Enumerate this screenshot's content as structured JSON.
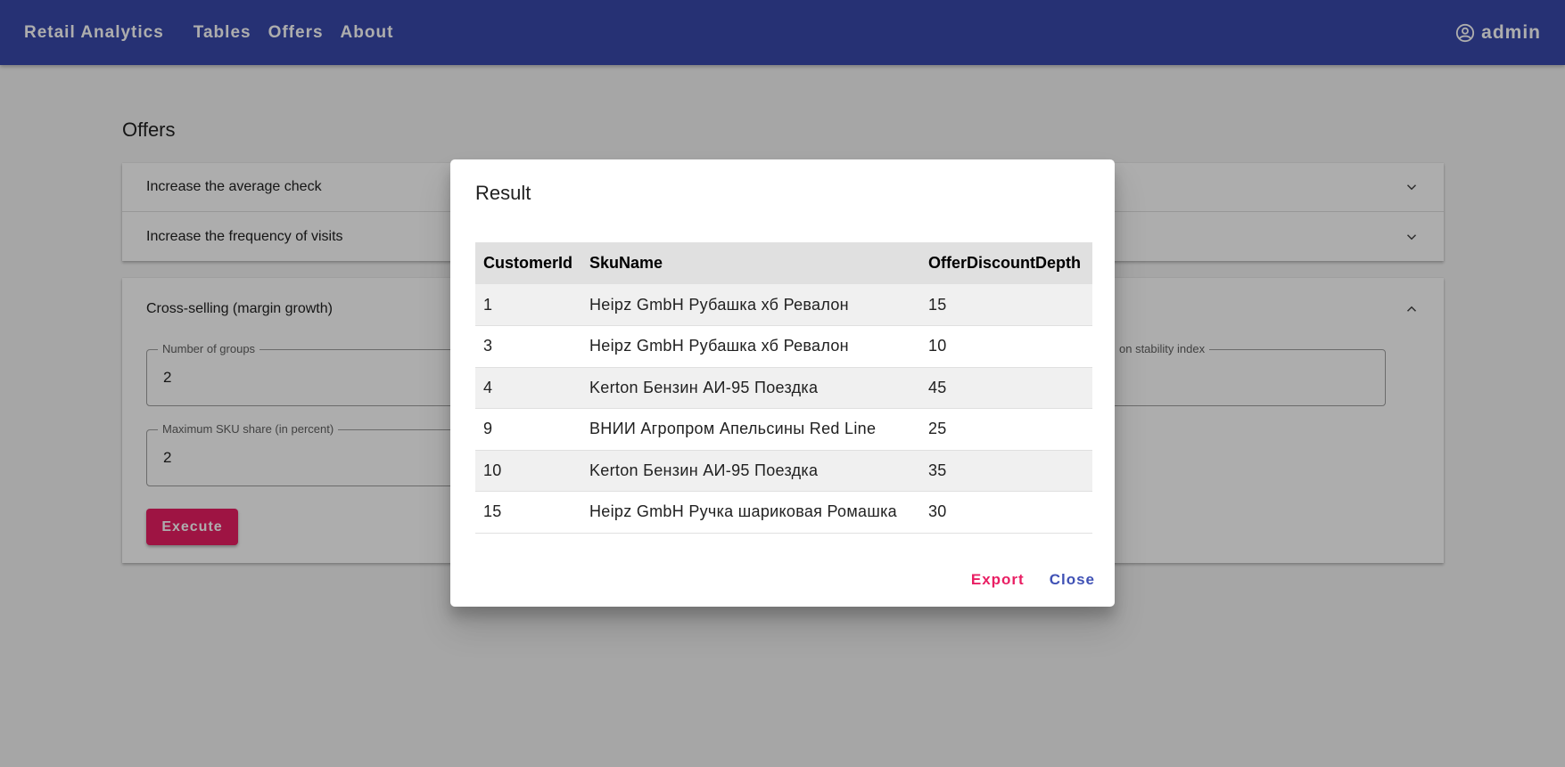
{
  "app": {
    "brand": "Retail Analytics",
    "nav": [
      "Tables",
      "Offers",
      "About"
    ],
    "user": "admin"
  },
  "page": {
    "title": "Offers",
    "panels": {
      "avg_check": "Increase the average check",
      "frequency": "Increase the frequency of visits",
      "cross_selling": "Cross-selling (margin growth)"
    },
    "form": {
      "groups_label": "Number of groups",
      "groups_value": "2",
      "churn_label": "on stability index",
      "churn_value": "",
      "sku_share_label": "Maximum SKU share (in percent)",
      "sku_share_value": "2",
      "execute": "Execute"
    }
  },
  "dialog": {
    "title": "Result",
    "columns": [
      "CustomerId",
      "SkuName",
      "OfferDiscountDepth"
    ],
    "rows": [
      [
        "1",
        "Heipz GmbH Рубашка хб Ревалон",
        "15"
      ],
      [
        "3",
        "Heipz GmbH Рубашка хб Ревалон",
        "10"
      ],
      [
        "4",
        "Kerton Бензин АИ-95 Поездка",
        "45"
      ],
      [
        "9",
        "ВНИИ Агропром Апельсины Red Line",
        "25"
      ],
      [
        "10",
        "Kerton Бензин АИ-95 Поездка",
        "35"
      ],
      [
        "15",
        "Heipz GmbH Ручка шариковая Ромашка",
        "30"
      ]
    ],
    "export": "Export",
    "close": "Close",
    "colors": {
      "export": "#e91e63",
      "close": "#3f51b5"
    }
  },
  "colors": {
    "appbar": "#3949ab",
    "accent": "#e91e63",
    "overlay": "rgba(0,0,0,0.32)"
  },
  "icons": {
    "user": "account-circle-icon",
    "collapse": "chevron-down-icon",
    "expand": "chevron-up-icon"
  }
}
